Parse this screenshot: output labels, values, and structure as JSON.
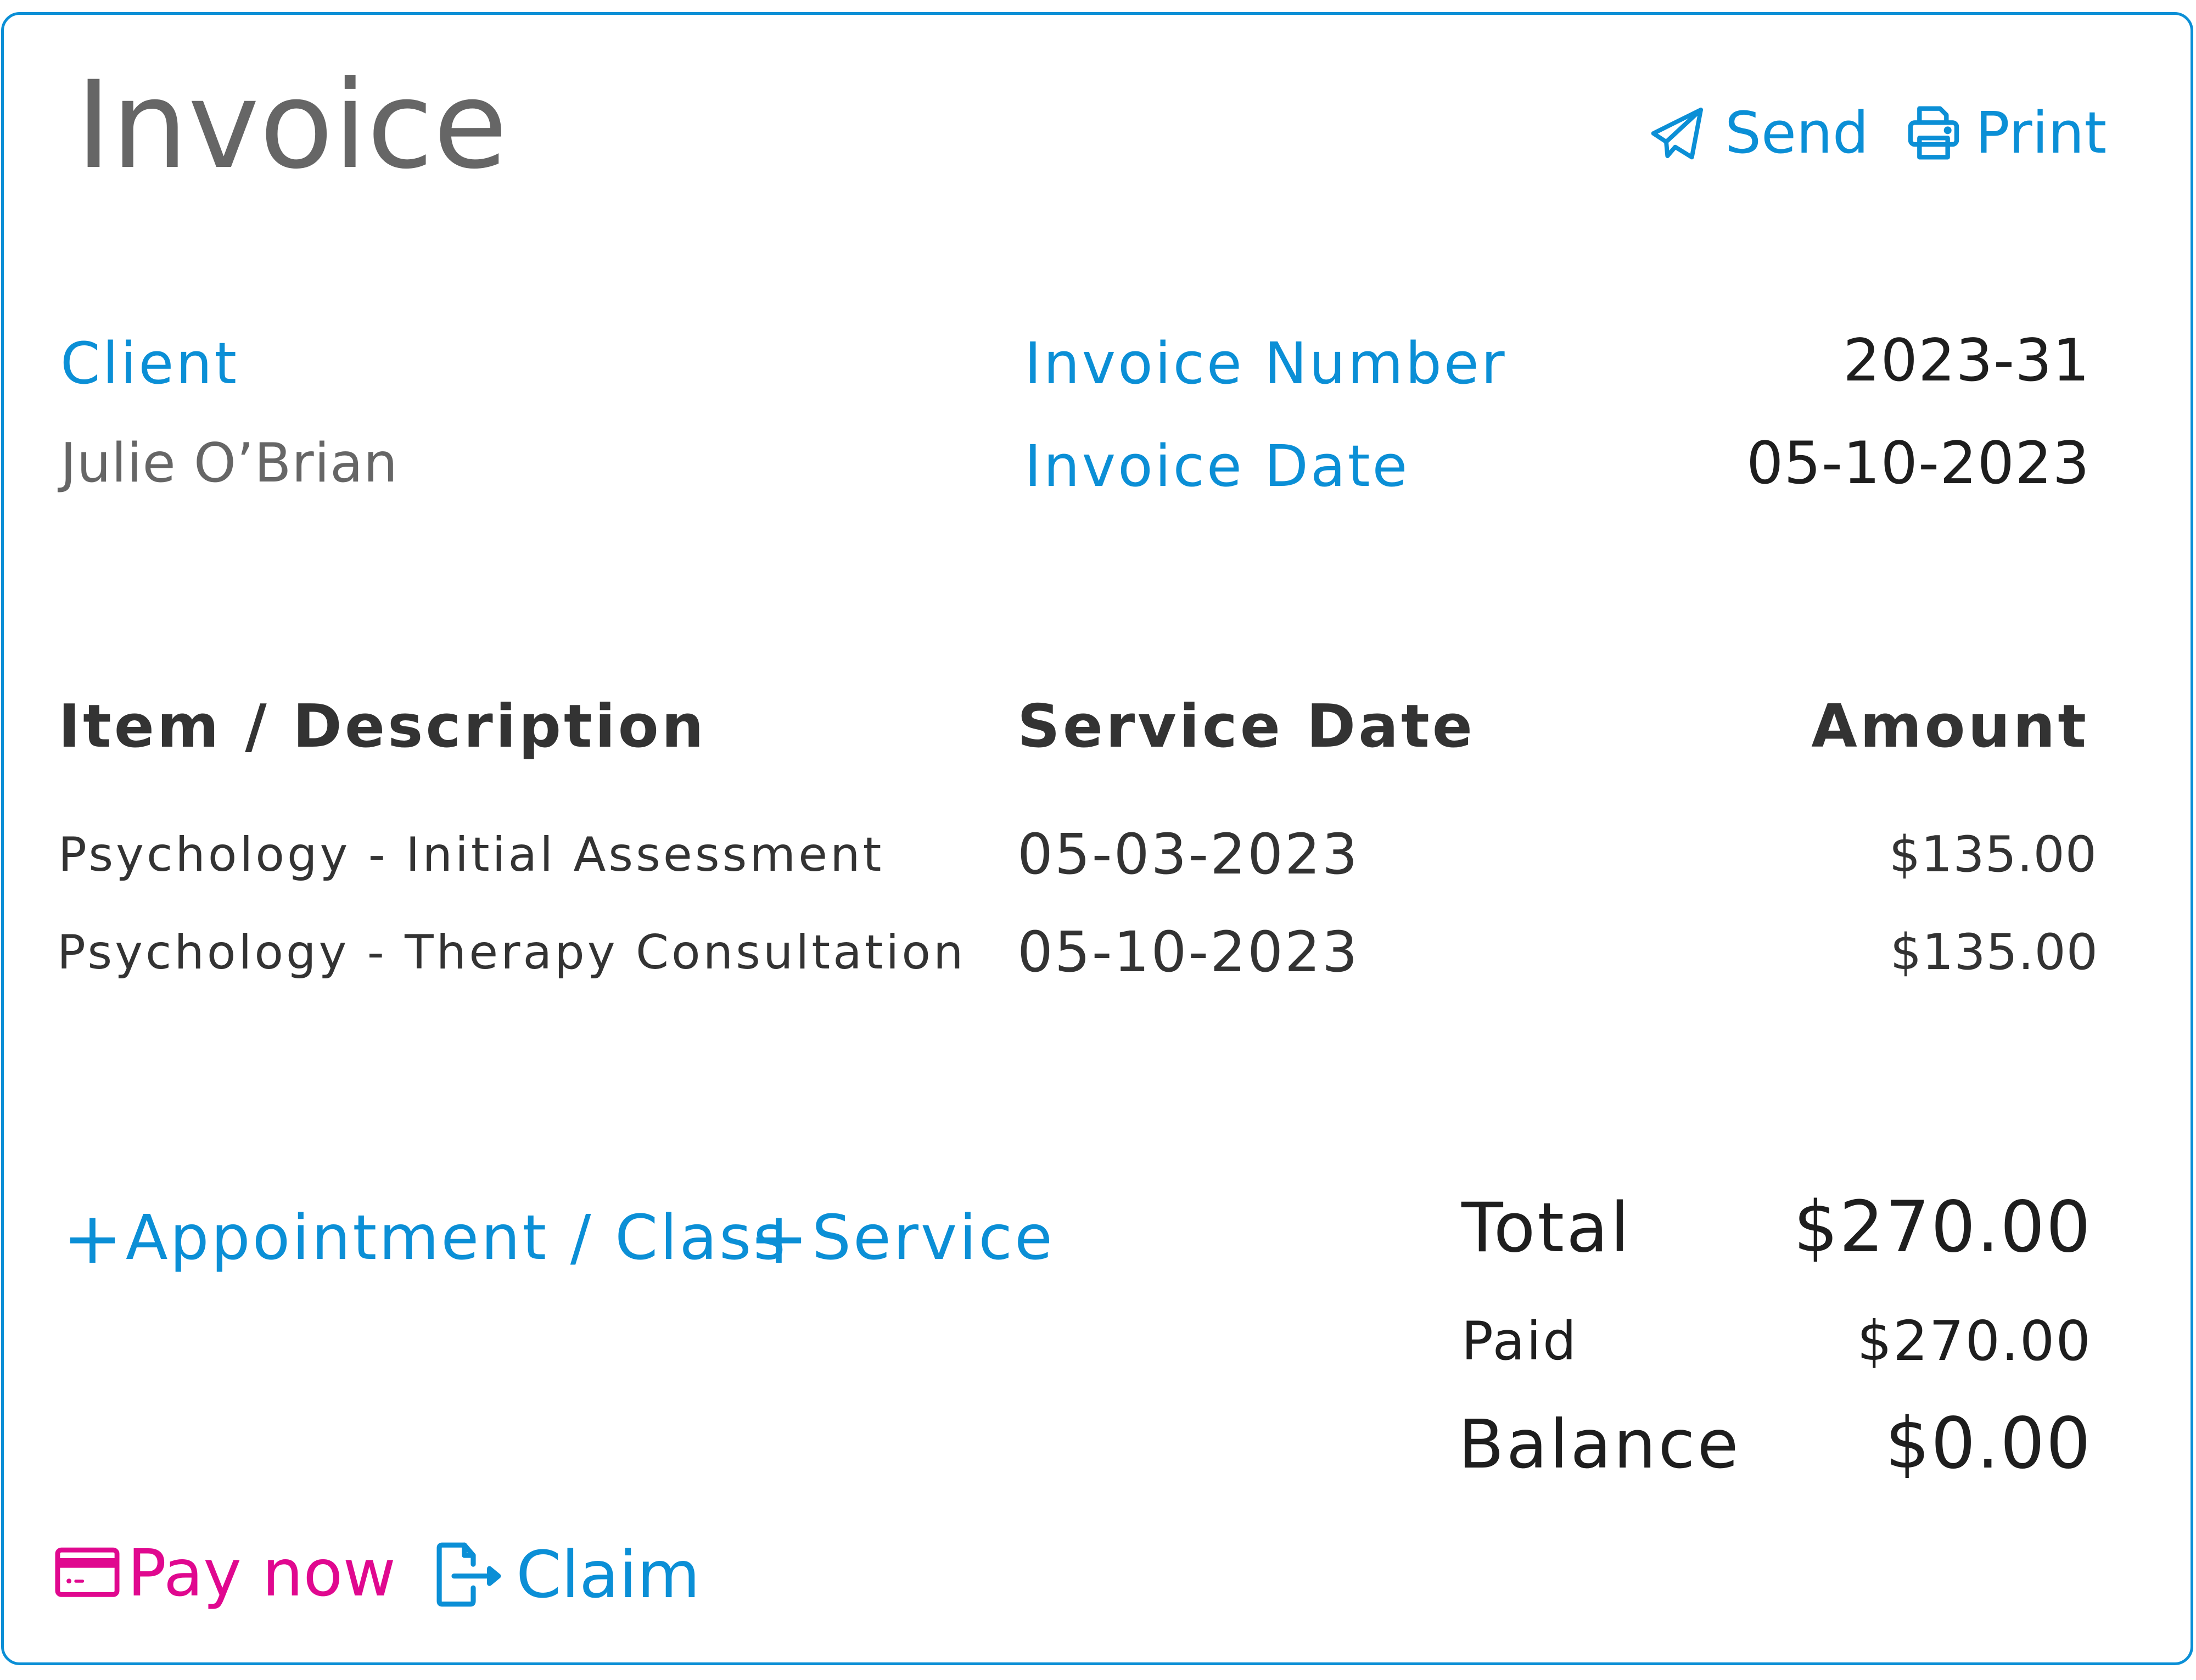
{
  "header": {
    "title": "Invoice",
    "actions": [
      {
        "label": "Send",
        "icon": "paper-plane-icon"
      },
      {
        "label": "Print",
        "icon": "printer-icon"
      }
    ]
  },
  "client": {
    "label": "Client",
    "name": "Julie O’Brian"
  },
  "meta": {
    "invoice_number_label": "Invoice Number",
    "invoice_number": "2023-31",
    "invoice_date_label": "Invoice Date",
    "invoice_date": "05-10-2023"
  },
  "table": {
    "columns": [
      "Item / Description",
      "Service Date",
      "Amount"
    ],
    "rows": [
      {
        "description": "Psychology - Initial Assessment",
        "service_date": "05-03-2023",
        "amount": "$135.00"
      },
      {
        "description": "Psychology - Therapy Consultation",
        "service_date": "05-10-2023",
        "amount": "$135.00"
      }
    ]
  },
  "add_actions": [
    {
      "label": "Appointment / Class",
      "icon": "plus-icon"
    },
    {
      "label": "Service",
      "icon": "plus-icon"
    }
  ],
  "summary": {
    "total_label": "Total",
    "total": "$270.00",
    "paid_label": "Paid",
    "paid": "$270.00",
    "balance_label": "Balance",
    "balance": "$0.00"
  },
  "footer_actions": [
    {
      "label": "Pay now",
      "icon": "credit-card-icon",
      "color": "#e0088f"
    },
    {
      "label": "Claim",
      "icon": "file-export-icon",
      "color": "#0b8fd6"
    }
  ],
  "colors": {
    "accent": "#0b8fd6",
    "pay": "#e0088f",
    "title": "#666666",
    "text": "#1e1e1e"
  }
}
